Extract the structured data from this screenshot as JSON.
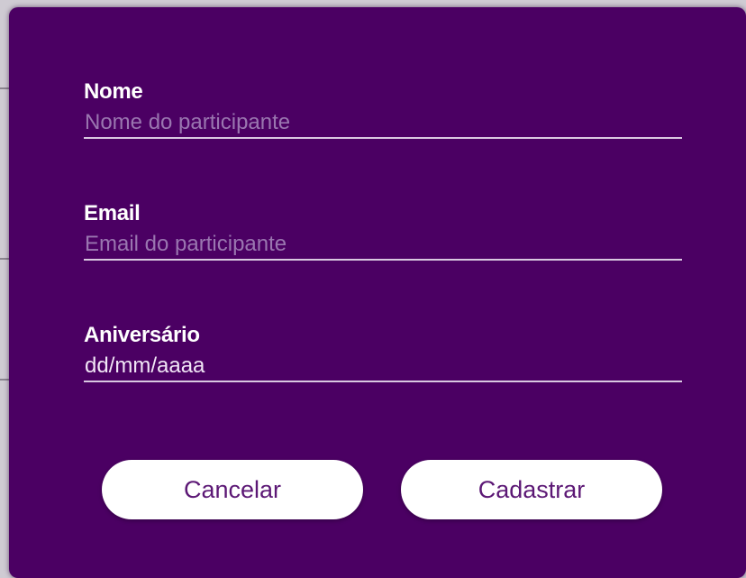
{
  "form": {
    "name": {
      "label": "Nome",
      "placeholder": "Nome do participante",
      "value": ""
    },
    "email": {
      "label": "Email",
      "placeholder": "Email do participante",
      "value": ""
    },
    "birthday": {
      "label": "Aniversário",
      "placeholder": "dd/mm/aaaa",
      "value": ""
    }
  },
  "actions": {
    "cancel_label": "Cancelar",
    "submit_label": "Cadastrar"
  },
  "colors": {
    "modal_background": "#4b0063",
    "button_background": "#ffffff",
    "button_text": "#5c1875",
    "label_text": "#ffffff",
    "placeholder_text": "#9a76b0",
    "underline": "#d9c8e1"
  }
}
